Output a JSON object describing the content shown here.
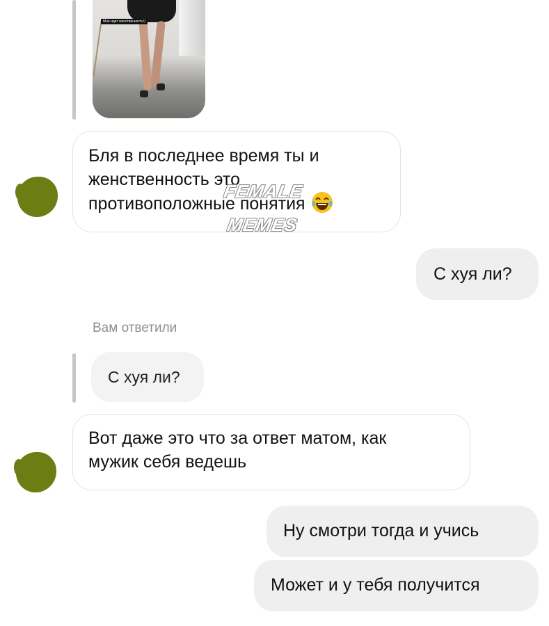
{
  "shared_photo": {
    "caption": "Мне идет женственность!)"
  },
  "messages": {
    "m1": {
      "line1": "Бля в последнее время ты и",
      "line2": "женственность это",
      "line3": "противоположные понятия"
    },
    "m2": "С хуя ли?",
    "reply_label": "Вам ответили",
    "quoted_text": "С хуя ли?",
    "m3": {
      "line1": "Вот даже это что за ответ матом, как",
      "line2": "мужик себя ведешь"
    },
    "m4": "Ну смотри тогда и учись",
    "m5": "Может и у тебя получится"
  },
  "watermark": {
    "line1": "FEMALE",
    "line2": "MEMES"
  },
  "icons": {
    "emoji": "face-with-tears-of-joy",
    "avatar_color": "#6b7d13"
  }
}
